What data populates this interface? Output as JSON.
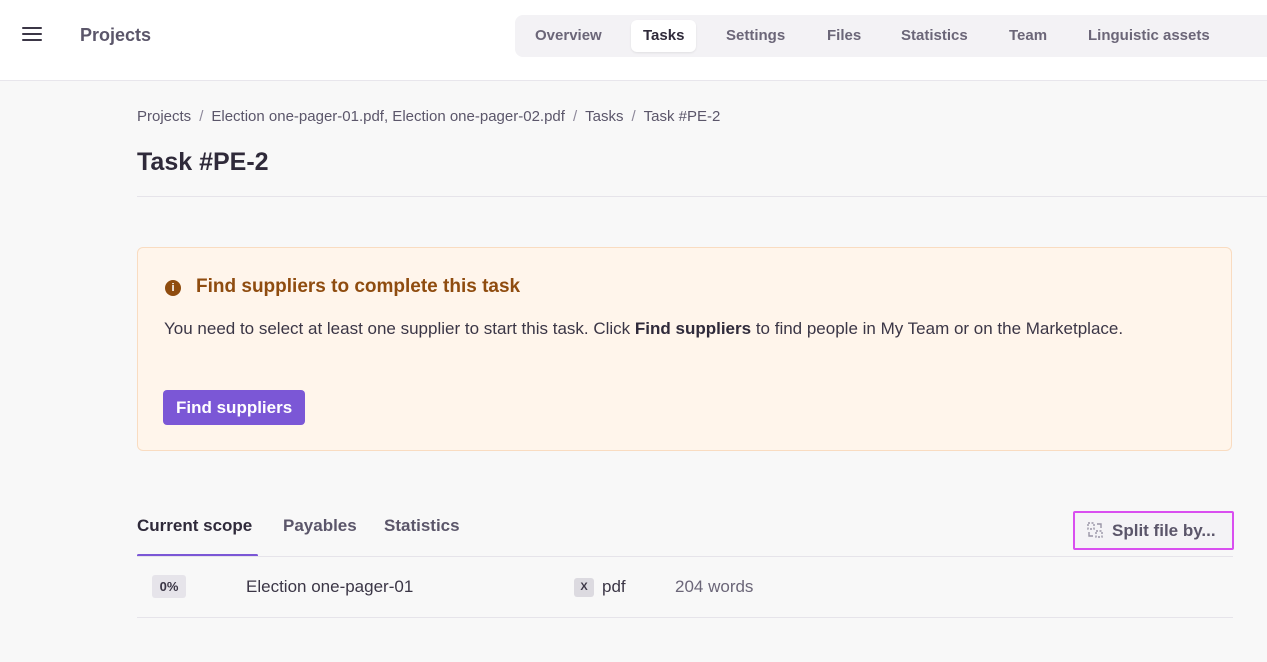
{
  "header": {
    "app_title": "Projects",
    "tabs": [
      "Overview",
      "Tasks",
      "Settings",
      "Files",
      "Statistics",
      "Team",
      "Linguistic assets"
    ],
    "active_tab": "Tasks"
  },
  "breadcrumb": [
    "Projects",
    "Election one-pager-01.pdf, Election one-pager-02.pdf",
    "Tasks",
    "Task #PE-2"
  ],
  "page_title": "Task #PE-2",
  "alert": {
    "title": "Find suppliers to complete this task",
    "text_before": "You need to select at least one supplier to start this task. Click ",
    "text_bold": "Find suppliers",
    "text_after": " to find people in My Team or on the Marketplace.",
    "button_label": "Find suppliers",
    "icon": "info-icon"
  },
  "scope_tabs": [
    "Current scope",
    "Payables",
    "Statistics"
  ],
  "active_scope_tab": "Current scope",
  "split_button": {
    "label": "Split file by...",
    "icon": "split-icon"
  },
  "files": [
    {
      "progress": "0%",
      "name": "Election one-pager-01",
      "type_icon": "X",
      "ext": "pdf",
      "words": "204 words"
    }
  ],
  "colors": {
    "accent": "#7b57d6",
    "alert_bg": "#fff5eb",
    "alert_title": "#8f4c0f",
    "highlight_border": "#d94ff0"
  }
}
